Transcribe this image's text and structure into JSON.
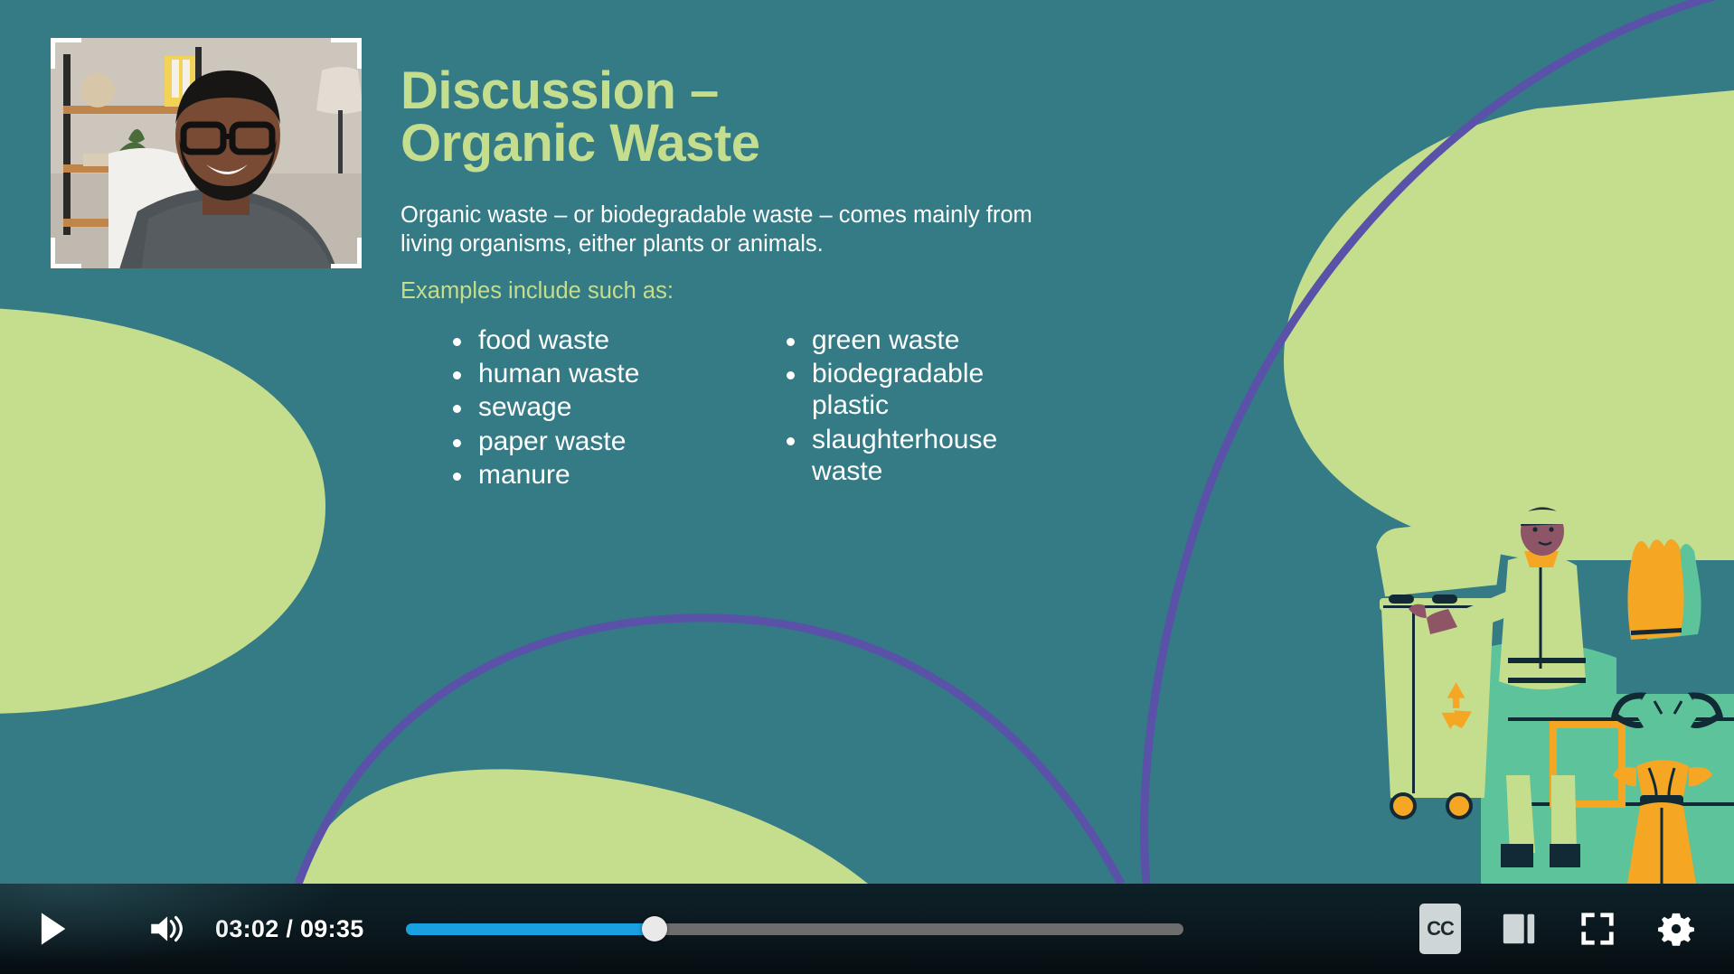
{
  "slide": {
    "title": "Discussion –\nOrganic Waste",
    "intro_paragraph": "Organic waste – or biodegradable waste – comes mainly from living organisms, either plants or animals.",
    "examples_lead": "Examples include such as:",
    "bullets_left": [
      "food waste",
      "human waste",
      "sewage",
      "paper waste",
      "manure"
    ],
    "bullets_right": [
      "green waste",
      "biodegradable plastic",
      "slaughterhouse waste"
    ],
    "colors": {
      "background_teal": "#357b85",
      "accent_green": "#c5de8e",
      "purple_arc": "#5a51a8",
      "body_text": "#ffffff",
      "illustration_orange": "#f5a623",
      "illustration_mint": "#5cc39a",
      "illustration_dark": "#122a35"
    }
  },
  "player": {
    "play_label": "Play",
    "volume_label": "Volume",
    "time_current": "03:02",
    "time_total": "09:35",
    "time_display": "03:02 / 09:35",
    "progress_percent": 32,
    "cc_label": "CC",
    "theater_label": "Theater mode",
    "fullscreen_label": "Fullscreen",
    "settings_label": "Settings",
    "colors": {
      "progress_filled": "#18a0e0",
      "progress_track": "#6d6d6d",
      "handle": "#e9e9e9"
    }
  }
}
